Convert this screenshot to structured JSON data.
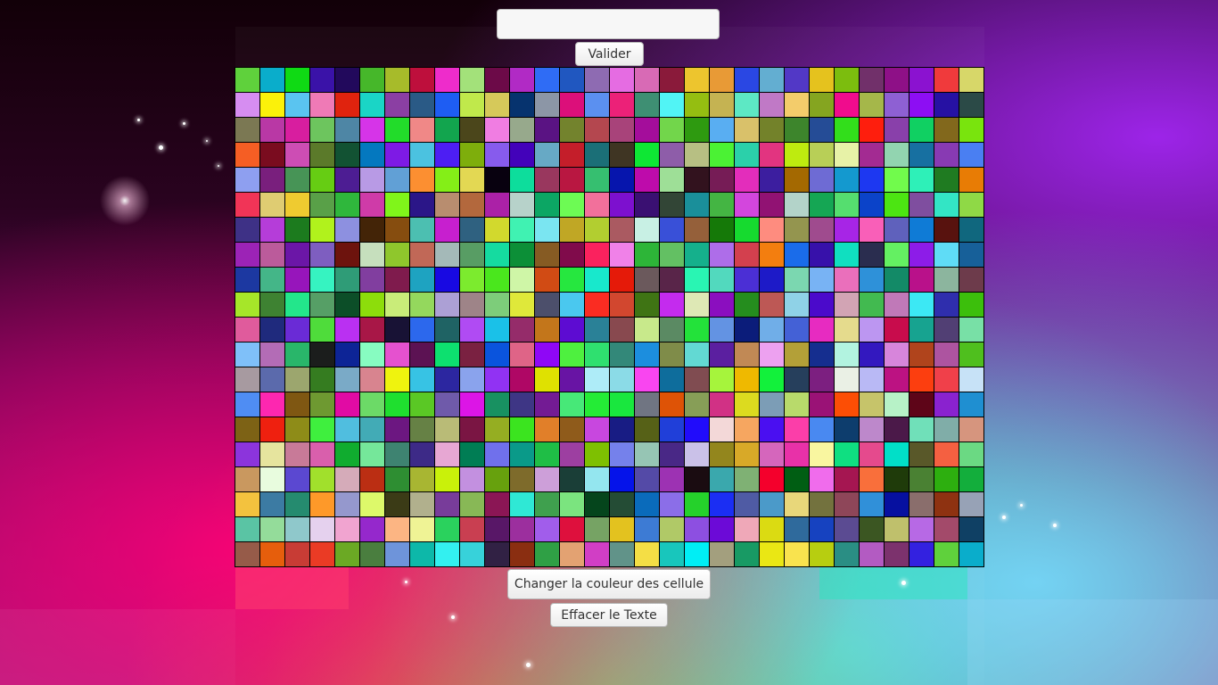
{
  "input": {
    "value": "",
    "placeholder": ""
  },
  "buttons": {
    "validate_label": "Valider",
    "change_color_label": "Changer la couleur des cellule",
    "clear_text_label": "Effacer le Texte"
  },
  "grid": {
    "rows": 20,
    "cols": 30,
    "palette": [
      "#5fd13c",
      "#0aadcb",
      "#0fda14",
      "#3a12a8",
      "#22095c",
      "#46b72a",
      "#a7bb2a",
      "#be0f3c",
      "#ee2ccb",
      "#a3e17a",
      "#6c0a48",
      "#b12ac5",
      "#2f6cf5",
      "#2057c0",
      "#8e6bb2",
      "#e56ce2",
      "#d86ab5",
      "#8a1a3a",
      "#edc52e",
      "#e89a36",
      "#2a47e3",
      "#63aed1",
      "#5238c6",
      "#e5c21e",
      "#7cbd0e",
      "#71306a",
      "#8e1087",
      "#8b12d0",
      "#f03a3c",
      "#d7d769",
      "#d68df1",
      "#fbf10a",
      "#5ac4f0",
      "#ef7ab6",
      "#e0230e",
      "#1ad5c6",
      "#8b3fa3",
      "#2a5a86",
      "#1e5df3",
      "#c0e94b",
      "#d6c95a",
      "#06336e",
      "#8c96a6",
      "#dc0f7a",
      "#5b90f0",
      "#ec2178",
      "#3e8f73",
      "#51f4f5",
      "#95be11",
      "#c5b352",
      "#5de8c4",
      "#c079c6",
      "#f3cc6b",
      "#85a520",
      "#f00c8d",
      "#a5b74a",
      "#8e60d3",
      "#8d0ef3",
      "#2611a3",
      "#2b4a47",
      "#7b7853",
      "#b938a5",
      "#d81e9f",
      "#6dc55e",
      "#4e86a5",
      "#d634e8",
      "#22dc2a",
      "#f08887",
      "#12a54e",
      "#4b461b",
      "#f07de2",
      "#97a98c",
      "#5a1383",
      "#73832d",
      "#b4474f",
      "#a8437a",
      "#a40d9b",
      "#72d64b",
      "#2e9a10",
      "#59aef2",
      "#d9c16a",
      "#73822a",
      "#3d852c",
      "#254c96",
      "#32de1b",
      "#fe1e0d",
      "#8940aa",
      "#10d062",
      "#82681c",
      "#79e40d",
      "#f55e24",
      "#7a0c1f",
      "#cd4db4",
      "#5b7a2a",
      "#125233",
      "#0478bf",
      "#7e1ae5",
      "#4bc2e0",
      "#4d1ef3",
      "#7eae0c",
      "#875bed",
      "#4302ba",
      "#67a9c5",
      "#c41e2a",
      "#1b6f77",
      "#3f3523",
      "#0ee734",
      "#8e5da9",
      "#b7bf83",
      "#4bf234",
      "#2bd0aa",
      "#e23480",
      "#beeb0f",
      "#b8cf57",
      "#e7f2a7",
      "#a32b92",
      "#92d4b0",
      "#1770a1",
      "#883ab3",
      "#4a7ff2",
      "#8e9ff0",
      "#791f7d",
      "#479456",
      "#66cd13",
      "#4d1d93",
      "#b89ae5",
      "#61a0d6",
      "#fc8f31",
      "#84ef17",
      "#e3d853",
      "#08010f",
      "#0ddd9c",
      "#99375e",
      "#b91741",
      "#36bf70",
      "#0615ad",
      "#be0bab",
      "#9edf97",
      "#32121e",
      "#761c56",
      "#e32dbb",
      "#3c1e9f",
      "#a46901",
      "#6e6bd4",
      "#1499cf",
      "#1d38f1",
      "#71fb4c",
      "#2ef0b8",
      "#1f7b21",
      "#e87c05",
      "#f13457",
      "#dfcc72",
      "#efcb30",
      "#59a048",
      "#2fb73c",
      "#cf3ba8",
      "#80f51a",
      "#2b1688",
      "#b88d6f",
      "#b3683d",
      "#ab21a7",
      "#b7d2ca",
      "#0ca664",
      "#6dfb54",
      "#f2709b",
      "#7d10cf",
      "#3a1072",
      "#324536",
      "#1a8f9a",
      "#44b543",
      "#d346dd",
      "#911273",
      "#b3d3c9",
      "#15a654",
      "#55de6f",
      "#0b43c9",
      "#4ce512",
      "#7f4e9f",
      "#33e5c5",
      "#8fd946",
      "#3e3186",
      "#b53dd9",
      "#1c7b1e",
      "#b1f21c",
      "#8d90e0",
      "#432407",
      "#864d0f",
      "#4cbfb1",
      "#c71fcf",
      "#2f6180",
      "#d2d92d",
      "#40f2b2",
      "#7ae5f1",
      "#c0a725",
      "#b2ce30",
      "#aa5a61",
      "#c8f0e4",
      "#3950d8",
      "#95603a",
      "#157908",
      "#16da2f",
      "#fe8c7f",
      "#94954f",
      "#9f4b8e",
      "#a725e6",
      "#f95fb8",
      "#5f61bc",
      "#0f7bd6",
      "#58120e",
      "#10677e",
      "#9c23b6",
      "#bb5b9b",
      "#6b16a7",
      "#7e5ec0",
      "#6d130d",
      "#c6dfbd",
      "#8fc72c",
      "#c16857",
      "#a4b9b8",
      "#589d64",
      "#15dba0",
      "#0c8f37",
      "#865b23",
      "#800b4b",
      "#fa225e",
      "#f081e8",
      "#2db538",
      "#63c063",
      "#15b08c",
      "#ae6de9",
      "#d3404e",
      "#f37e0f",
      "#1a6cea",
      "#3711aa",
      "#10dfc0",
      "#2a2d4f",
      "#64f062",
      "#8d1ce8",
      "#5fdcf6",
      "#176099",
      "#1c38a1",
      "#44b688",
      "#9715bb",
      "#36f3c1",
      "#2f9c77",
      "#813e9f",
      "#7f1b4d",
      "#1ea3c1",
      "#1809e2",
      "#7ceb2e",
      "#4ae71d",
      "#cff6a7",
      "#d14b14",
      "#26e73f",
      "#18e8cc",
      "#e51a09",
      "#6b595c",
      "#592549",
      "#29f5b3",
      "#52d9be",
      "#4b2fd5",
      "#1d1ac8",
      "#7bd7b0",
      "#78b3f4",
      "#ea6fbb",
      "#2e91d9",
      "#138a67",
      "#b9118a",
      "#8cb59e",
      "#6d3b4b",
      "#a6e629",
      "#3e8232",
      "#23e68b",
      "#569f66",
      "#0c4e28",
      "#8ddd0b",
      "#c9ec79",
      "#94d85d",
      "#aca0d5",
      "#9e8488",
      "#7dcd7a",
      "#dfe83a",
      "#4c4f6b",
      "#4ac8ef",
      "#fa2c22",
      "#d2472f",
      "#3f7414",
      "#c42bee",
      "#dee8b5",
      "#8b0ebf",
      "#258d1e",
      "#bd5855",
      "#8fd2e7",
      "#4b0acb",
      "#d2a4b4",
      "#42ba50",
      "#c079b8",
      "#3ce8f4",
      "#2f2ead",
      "#3cbf0c",
      "#e05b9c",
      "#1f2a7d",
      "#6a2bd6",
      "#4fdc3b",
      "#ba30f2",
      "#a81747",
      "#181235",
      "#2c68ed",
      "#1f6364",
      "#b04bf3",
      "#1ac1e8",
      "#952c6a",
      "#c3761b",
      "#5d0cd2",
      "#2a8197",
      "#88494f",
      "#c8e98b",
      "#5b8a63",
      "#23e23a",
      "#6393e3",
      "#0b1c7a",
      "#70aee8",
      "#4461d6",
      "#e72bc1",
      "#e5db8d",
      "#bc96f1",
      "#c80c4c",
      "#17a390",
      "#513f74",
      "#78e0a6",
      "#7fc0f9",
      "#b36cb6",
      "#29b66a",
      "#1b1d1c",
      "#0d2496",
      "#87fcc1",
      "#e551cf",
      "#5c1253",
      "#0de06f",
      "#7a2141",
      "#0a54dd",
      "#df6487",
      "#8f07f6",
      "#4ef03f",
      "#2fe06f",
      "#338879",
      "#1c8ede",
      "#7f8c49",
      "#62d9d3",
      "#5b1fa0",
      "#c18955",
      "#eda1f0",
      "#b3a038",
      "#152e8f",
      "#b2f3e0",
      "#3318bf",
      "#d785db",
      "#b0441c",
      "#ad54a0",
      "#4fbf1e",
      "#a79aa0",
      "#5b6aac",
      "#9ca66e",
      "#357c20",
      "#7aaac7",
      "#d8848f",
      "#eff30e",
      "#37c3e4",
      "#2c26a0",
      "#8aa3ed",
      "#9132f3",
      "#af0765",
      "#dfe101",
      "#6814a4",
      "#aeecf8",
      "#8bdbe7",
      "#f945f0",
      "#0e6d9c",
      "#804c51",
      "#a6f43c",
      "#efb900",
      "#12f13b",
      "#263f5c",
      "#7c1f80",
      "#eaf0e5",
      "#b9b9f5",
      "#bc1282",
      "#fc3e0f",
      "#f0404a",
      "#c7e2f7",
      "#4f8df3",
      "#fd27b0",
      "#7f5712",
      "#6e9931",
      "#e10ba4",
      "#6cda67",
      "#1fdf2f",
      "#5ac825",
      "#6f5aaa",
      "#dc15e6",
      "#189161",
      "#3e3685",
      "#731b94",
      "#47e878",
      "#24ec36",
      "#19e73e",
      "#707582",
      "#de5306",
      "#879e57",
      "#d13185",
      "#dcdb1f",
      "#7c9db6",
      "#b8da6b",
      "#9a1276",
      "#fc4e05",
      "#c6c46a",
      "#b7f2c7",
      "#5e0518",
      "#8a22cf",
      "#1f8fd1",
      "#7d6215",
      "#ef200f",
      "#8e8c18",
      "#3fef3e",
      "#50bedf",
      "#42abb6",
      "#6c1781",
      "#668145",
      "#b9bb77",
      "#7a1543",
      "#95ae22",
      "#3be41f",
      "#e17f29",
      "#8f5b1b",
      "#c847df",
      "#181c84",
      "#566117",
      "#203fd9",
      "#210cfb",
      "#f3d8d8",
      "#f6a660",
      "#4a0ff1",
      "#fb3ea9",
      "#4989f1",
      "#0d3d6d",
      "#bd88cb",
      "#4b1949",
      "#70e0b9",
      "#80ada8",
      "#d6957e",
      "#8c34dc",
      "#e6e49e",
      "#c87a98",
      "#d95fac",
      "#10ac2f",
      "#75e79a",
      "#3e8371",
      "#3d2a87",
      "#e7a7d3",
      "#007d54",
      "#7070ec",
      "#0a9a89",
      "#1fbe46",
      "#9d3fa1",
      "#7ec001",
      "#7581eb",
      "#96c5b4",
      "#492886",
      "#cac1e8",
      "#93861d",
      "#d8a928",
      "#d566bc",
      "#e831a8",
      "#f9f6a0",
      "#0fdf81",
      "#e54a8d",
      "#01dfc8",
      "#595829",
      "#f46041",
      "#6bd983",
      "#c9985f",
      "#e8fcde",
      "#5b48d1",
      "#a1e02c",
      "#d5abb9",
      "#bb2e13",
      "#2e8e32",
      "#a8b632",
      "#c9f10a",
      "#c390e0",
      "#67a10d",
      "#7e6b2b",
      "#cd9fd9",
      "#1a3e37",
      "#94e6ef",
      "#0513ea",
      "#544aa7",
      "#9d32b3",
      "#1a0c11",
      "#3aa8ad",
      "#7fb174",
      "#f4002c",
      "#005e13",
      "#f06cec",
      "#a51651",
      "#f96f3b",
      "#1f3b0a",
      "#4a8133",
      "#2daf0f",
      "#13ae3c",
      "#f3c23e",
      "#3c7ba3",
      "#258b6f",
      "#fe9929",
      "#9598cd",
      "#ddf96a",
      "#3b3b16",
      "#b1b08d",
      "#783c9a",
      "#88b856",
      "#8b1655",
      "#2fe8d5",
      "#3fa04e",
      "#7be47f",
      "#05451c",
      "#244c35",
      "#0a6bbb",
      "#8b6ee8",
      "#25d12b",
      "#1b2ef3",
      "#4f5ba4",
      "#4b9ac9",
      "#e8d77a",
      "#73723e",
      "#8e4659",
      "#3090d9",
      "#0610a0",
      "#8a6e6c",
      "#8e3211",
      "#97a2b6",
      "#5ac4a4",
      "#94dc9a",
      "#8fc8cb",
      "#e5d1ee",
      "#f1a4d0",
      "#9528cc",
      "#fcb583",
      "#eff395",
      "#2ad25d",
      "#c93f51",
      "#581767",
      "#9c2f9e",
      "#a15deb",
      "#de103d",
      "#76a364",
      "#e3c21f",
      "#3d7bd4",
      "#b0c967",
      "#8d4fe1",
      "#6c0ad7",
      "#efa8b8",
      "#dbdb12",
      "#2f6a9c",
      "#1642c0",
      "#5b4b92",
      "#3b5622",
      "#bfc06c",
      "#b769e5",
      "#a34a6a",
      "#0f4064",
      "#965b49",
      "#e65e0c",
      "#c83c35",
      "#ea3b25",
      "#6ba924",
      "#4a7e3f",
      "#6e94da",
      "#0db8a9",
      "#33f0f0",
      "#37d2da",
      "#312144",
      "#8a2e11",
      "#2fa045",
      "#e3a272",
      "#d13ec5",
      "#619389",
      "#f4de45",
      "#18c6bc",
      "#00eef5",
      "#a39f7e",
      "#189a64",
      "#eae714",
      "#f9e34e",
      "#b7ce10",
      "#2a8e84",
      "#b35bc2",
      "#7c326d",
      "#3321e0"
    ]
  }
}
